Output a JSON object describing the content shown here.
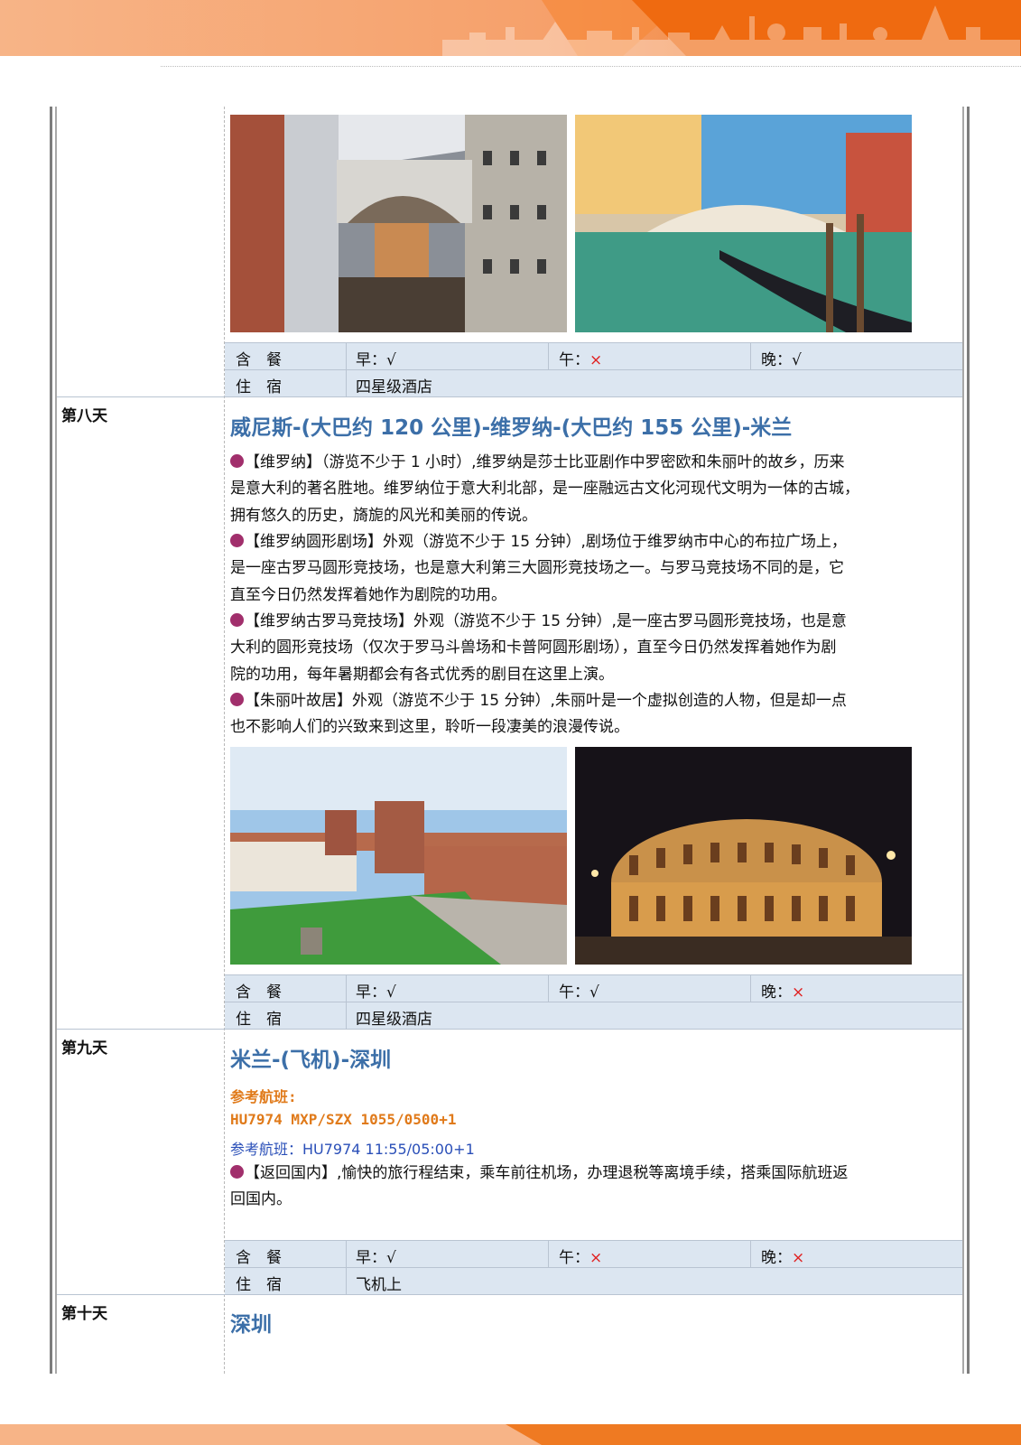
{
  "colors": {
    "accent_orange": "#f07b22",
    "title_blue": "#3c6fa8",
    "row_bg": "#dce6f1",
    "bullet": "#a12f6c",
    "flight_orange": "#e07a1a",
    "flight_blue": "#2a4fb8",
    "cross_red": "#e02020"
  },
  "labels": {
    "meal": "含　餐",
    "lodging": "住　宿"
  },
  "day7": {
    "meals": {
      "breakfast": "早：√",
      "lunch_prefix": "午：",
      "lunch_mark": "×",
      "dinner": "晚：√"
    },
    "lodging": "四星级酒店"
  },
  "day8": {
    "label": "第八天",
    "title": "威尼斯-(大巴约 120 公里)-维罗纳-(大巴约 155 公里)-米兰",
    "paragraphs": [
      [
        "【维罗纳】（游览不少于 1 小时）,维罗纳是莎士比亚剧作中罗密欧和朱丽叶的故乡，历来",
        "是意大利的著名胜地。维罗纳位于意大利北部，是一座融远古文化河现代文明为一体的古城，",
        "拥有悠久的历史，旖旎的风光和美丽的传说。"
      ],
      [
        "【维罗纳圆形剧场】外观（游览不少于 15 分钟）,剧场位于维罗纳市中心的布拉广场上，",
        "是一座古罗马圆形竞技场，也是意大利第三大圆形竞技场之一。与罗马竞技场不同的是，它",
        "直至今日仍然发挥着她作为剧院的功用。"
      ],
      [
        "【维罗纳古罗马竞技场】外观（游览不少于 15 分钟）,是一座古罗马圆形竞技场，也是意",
        "大利的圆形竞技场（仅次于罗马斗兽场和卡普阿圆形剧场），直至今日仍然发挥着她作为剧",
        "院的功用，每年暑期都会有各式优秀的剧目在这里上演。"
      ],
      [
        "【朱丽叶故居】外观（游览不少于 15 分钟）,朱丽叶是一个虚拟创造的人物，但是却一点",
        "也不影响人们的兴致来到这里，聆听一段凄美的浪漫传说。"
      ]
    ],
    "meals": {
      "breakfast": "早：√",
      "lunch": "午：√",
      "dinner_prefix": "晚：",
      "dinner_mark": "×"
    },
    "lodging": "四星级酒店"
  },
  "day9": {
    "label": "第九天",
    "title": "米兰-(飞机)-深圳",
    "flight_ref_label": "参考航班:",
    "flight_ref_detail": "HU7974  MXP/SZX  1055/0500+1",
    "flight_ref_alt": "参考航班：HU7974 11:55/05:00+1",
    "paragraph": [
      "【返回国内】,愉快的旅行程结束，乘车前往机场，办理退税等离境手续，搭乘国际航班返",
      "回国内。"
    ],
    "meals": {
      "breakfast": "早：√",
      "lunch_prefix": "午：",
      "lunch_mark": "×",
      "dinner_prefix": "晚：",
      "dinner_mark": "×"
    },
    "lodging": "飞机上"
  },
  "day10": {
    "label": "第十天",
    "title": "深圳"
  }
}
